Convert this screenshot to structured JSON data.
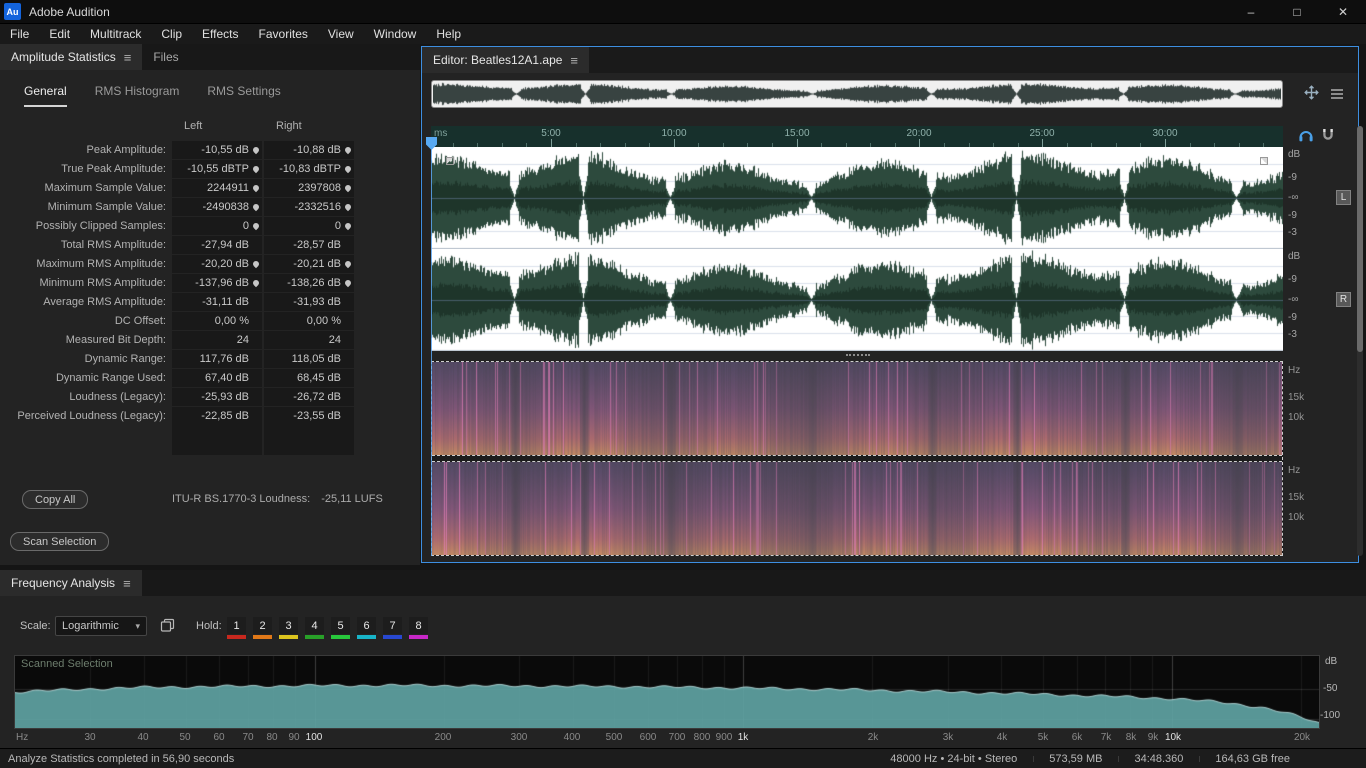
{
  "window": {
    "app_title": "Adobe Audition",
    "logo": "Au",
    "controls": {
      "minimize": "–",
      "maximize": "□",
      "close": "✕"
    }
  },
  "menubar": {
    "items": [
      "File",
      "Edit",
      "Multitrack",
      "Clip",
      "Effects",
      "Favorites",
      "View",
      "Window",
      "Help"
    ]
  },
  "amplitude_stats": {
    "tab": "Amplitude Statistics",
    "files_tab": "Files",
    "subtabs": [
      "General",
      "RMS Histogram",
      "RMS Settings"
    ],
    "active_subtab": "General",
    "col_headers": [
      "Left",
      "Right"
    ],
    "rows": [
      {
        "label": "Peak Amplitude:",
        "left": "-10,55 dB",
        "right": "-10,88 dB",
        "marker": true
      },
      {
        "label": "True Peak Amplitude:",
        "left": "-10,55 dBTP",
        "right": "-10,83 dBTP",
        "marker": true
      },
      {
        "label": "Maximum Sample Value:",
        "left": "2244911",
        "right": "2397808",
        "marker": true
      },
      {
        "label": "Minimum Sample Value:",
        "left": "-2490838",
        "right": "-2332516",
        "marker": true
      },
      {
        "label": "Possibly Clipped Samples:",
        "left": "0",
        "right": "0",
        "marker": true
      },
      {
        "label": "Total RMS Amplitude:",
        "left": "-27,94 dB",
        "right": "-28,57 dB",
        "marker": false
      },
      {
        "label": "Maximum RMS Amplitude:",
        "left": "-20,20 dB",
        "right": "-20,21 dB",
        "marker": true
      },
      {
        "label": "Minimum RMS Amplitude:",
        "left": "-137,96 dB",
        "right": "-138,26 dB",
        "marker": true
      },
      {
        "label": "Average RMS Amplitude:",
        "left": "-31,11 dB",
        "right": "-31,93 dB",
        "marker": false
      },
      {
        "label": "DC Offset:",
        "left": "0,00 %",
        "right": "0,00 %",
        "marker": false
      },
      {
        "label": "Measured Bit Depth:",
        "left": "24",
        "right": "24",
        "marker": false
      },
      {
        "label": "Dynamic Range:",
        "left": "117,76 dB",
        "right": "118,05 dB",
        "marker": false
      },
      {
        "label": "Dynamic Range Used:",
        "left": "67,40 dB",
        "right": "68,45 dB",
        "marker": false
      },
      {
        "label": "Loudness (Legacy):",
        "left": "-25,93 dB",
        "right": "-26,72 dB",
        "marker": false
      },
      {
        "label": "Perceived Loudness (Legacy):",
        "left": "-22,85 dB",
        "right": "-23,55 dB",
        "marker": false
      }
    ],
    "copy_all": "Copy All",
    "loudness_label": "ITU-R BS.1770-3 Loudness:",
    "loudness_value": "-25,11 LUFS",
    "scan_selection": "Scan Selection"
  },
  "editor": {
    "tab": "Editor: Beatles12A1.ape",
    "timeline_unit": "ms",
    "timeline_labels": [
      "5:00",
      "10:00",
      "15:00",
      "20:00",
      "25:00",
      "30:00"
    ],
    "db_ruler": [
      "dB",
      "-9",
      "-∞",
      "-9",
      "-3"
    ],
    "channel_badges": [
      "L",
      "R"
    ],
    "hz_ruler": [
      "Hz",
      "15k",
      "10k"
    ]
  },
  "frequency_analysis": {
    "tab": "Frequency Analysis",
    "scale_label": "Scale:",
    "scale_value": "Logarithmic",
    "hold_label": "Hold:",
    "hold_buttons": [
      {
        "label": "1",
        "color": "#c8281e"
      },
      {
        "label": "2",
        "color": "#e07818"
      },
      {
        "label": "3",
        "color": "#dcc41e"
      },
      {
        "label": "4",
        "color": "#28a028"
      },
      {
        "label": "5",
        "color": "#28c83c"
      },
      {
        "label": "6",
        "color": "#18b4c8"
      },
      {
        "label": "7",
        "color": "#2848d0"
      },
      {
        "label": "8",
        "color": "#c828c8"
      }
    ],
    "graph_label": "Scanned Selection",
    "db_axis": [
      "dB",
      "-50",
      "-100"
    ],
    "hz_unit": "Hz",
    "hz_axis": [
      {
        "label": "30",
        "f": 30
      },
      {
        "label": "40",
        "f": 40
      },
      {
        "label": "50",
        "f": 50
      },
      {
        "label": "60",
        "f": 60
      },
      {
        "label": "70",
        "f": 70
      },
      {
        "label": "80",
        "f": 80
      },
      {
        "label": "90",
        "f": 90
      },
      {
        "label": "100",
        "f": 100,
        "major": true
      },
      {
        "label": "200",
        "f": 200
      },
      {
        "label": "300",
        "f": 300
      },
      {
        "label": "400",
        "f": 400
      },
      {
        "label": "500",
        "f": 500
      },
      {
        "label": "600",
        "f": 600
      },
      {
        "label": "700",
        "f": 700
      },
      {
        "label": "800",
        "f": 800
      },
      {
        "label": "900",
        "f": 900
      },
      {
        "label": "1k",
        "f": 1000,
        "major": true
      },
      {
        "label": "2k",
        "f": 2000
      },
      {
        "label": "3k",
        "f": 3000
      },
      {
        "label": "4k",
        "f": 4000
      },
      {
        "label": "5k",
        "f": 5000
      },
      {
        "label": "6k",
        "f": 6000
      },
      {
        "label": "7k",
        "f": 7000
      },
      {
        "label": "8k",
        "f": 8000
      },
      {
        "label": "9k",
        "f": 9000
      },
      {
        "label": "10k",
        "f": 10000,
        "major": true
      },
      {
        "label": "20k",
        "f": 20000
      }
    ],
    "curve": [
      [
        20,
        -55
      ],
      [
        30,
        -50
      ],
      [
        40,
        -47.5
      ],
      [
        60,
        -46
      ],
      [
        100,
        -44.5
      ],
      [
        150,
        -44
      ],
      [
        200,
        -44.5
      ],
      [
        300,
        -45
      ],
      [
        500,
        -46
      ],
      [
        800,
        -47.5
      ],
      [
        1000,
        -48.5
      ],
      [
        1500,
        -50.5
      ],
      [
        2000,
        -52
      ],
      [
        3000,
        -55
      ],
      [
        4000,
        -57
      ],
      [
        5000,
        -59
      ],
      [
        7000,
        -62
      ],
      [
        10000,
        -66
      ],
      [
        13000,
        -72
      ],
      [
        16000,
        -80
      ],
      [
        18000,
        -88
      ],
      [
        20000,
        -97
      ],
      [
        22050,
        -107
      ]
    ]
  },
  "statusbar": {
    "message": "Analyze Statistics completed in 56,90 seconds",
    "right_items": [
      "48000 Hz • 24-bit • Stereo",
      "573,59 MB",
      "34:48.360",
      "164,63 GB free"
    ]
  },
  "colors": {
    "accent_blue": "#3d8ee0",
    "waveform_green": "#2d4a3d",
    "selection_bg": "#ffffff",
    "spectro_pink": "#e06ab0",
    "freq_fill": "#5fa3a3"
  }
}
